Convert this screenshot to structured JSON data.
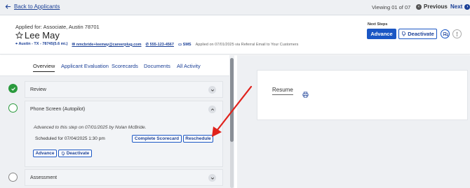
{
  "topbar": {
    "back_label": "Back to Applicants",
    "viewing": "Viewing 01 of 07",
    "previous_label": "Previous",
    "next_label": "Next"
  },
  "header": {
    "applied_for": "Applied for: Associate, Austin 78701",
    "candidate_name": "Lee May",
    "location": "Austin - TX - 78745(5.6 mi.)",
    "email": "nmcbride+leemay@careerplug.com",
    "phone": "555-123-4567",
    "sms": "SMS",
    "applied_on": "Applied on 07/01/2025 via Referral Email to Your Customers",
    "next_steps_label": "Next Steps",
    "advance_label": "Advance",
    "deactivate_label": "Deactivate"
  },
  "tabs": [
    {
      "label": "Overview"
    },
    {
      "label": "Applicant Evaluation"
    },
    {
      "label": "Scorecards"
    },
    {
      "label": "Documents"
    },
    {
      "label": "All Activity"
    }
  ],
  "steps": {
    "review": {
      "title": "Review"
    },
    "phone_screen": {
      "title": "Phone Screen (Autopilot)",
      "advanced_note": "Advanced to this step on 07/01/2025 by Nolan McBride.",
      "scheduled": "Scheduled for 07/04/2025 1:30 pm",
      "complete_scorecard_label": "Complete Scorecard",
      "reschedule_label": "Reschedule",
      "advance_label": "Advance",
      "deactivate_label": "Deactivate"
    },
    "assessment": {
      "title": "Assessment"
    }
  },
  "resume": {
    "label": "Resume"
  },
  "colors": {
    "accent": "#1a56c4",
    "link": "#1a3f96",
    "success": "#2a9a3d",
    "annotation_arrow": "#e0221c"
  },
  "icons": [
    "arrow-left-icon",
    "chevron-left-icon",
    "chevron-right-icon",
    "star-outline-icon",
    "pin-icon",
    "mail-icon",
    "phone-icon",
    "sms-icon",
    "thumbs-down-icon",
    "chat-icon",
    "more-icon",
    "check-icon",
    "chevron-down-icon",
    "chevron-up-icon",
    "print-icon"
  ]
}
